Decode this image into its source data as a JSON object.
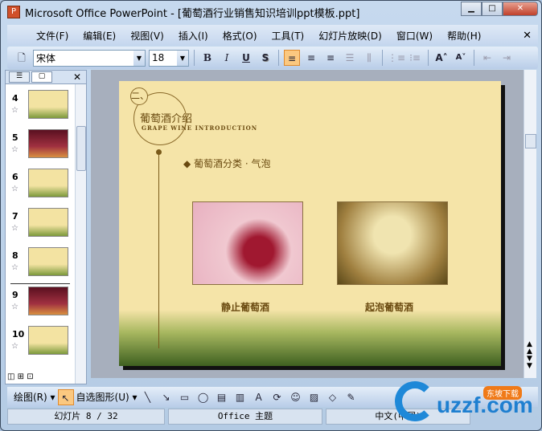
{
  "window": {
    "title": "Microsoft Office PowerPoint - [葡萄酒行业销售知识培训ppt模板.ppt]"
  },
  "menu": [
    "文件(F)",
    "编辑(E)",
    "视图(V)",
    "插入(I)",
    "格式(O)",
    "工具(T)",
    "幻灯片放映(D)",
    "窗口(W)",
    "帮助(H)"
  ],
  "toolbar": {
    "font": "宋体",
    "size": "18",
    "bold": "B",
    "italic": "I",
    "underline": "U",
    "shadow": "S"
  },
  "thumbnails": [
    {
      "n": "4"
    },
    {
      "n": "5",
      "dark": true
    },
    {
      "n": "6"
    },
    {
      "n": "7"
    },
    {
      "n": "8"
    },
    {
      "n": "9",
      "dark": true
    },
    {
      "n": "10"
    }
  ],
  "slide": {
    "num": "二、",
    "title": "葡萄酒介绍",
    "subtitle": "GRAPE WINE INTRODUCTION",
    "bullet": "◆ 葡萄酒分类 · 气泡",
    "caption1": "静止葡萄酒",
    "caption2": "起泡葡萄酒"
  },
  "drawbar": {
    "draw": "绘图(R) ▾",
    "autoshapes": "自选图形(U) ▾"
  },
  "status": {
    "slide": "幻灯片 8 / 32",
    "theme": "Office 主题",
    "lang": "中文(中国)"
  },
  "watermark": {
    "text": "uzzf.com",
    "badge": "东坡下载"
  }
}
